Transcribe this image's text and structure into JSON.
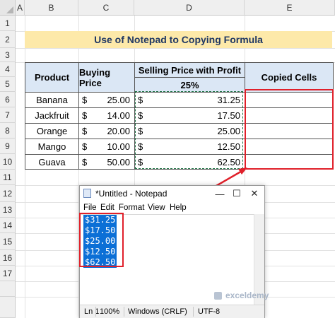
{
  "spreadsheet": {
    "columns": [
      "A",
      "B",
      "C",
      "D",
      "E"
    ],
    "rows": [
      "1",
      "2",
      "3",
      "4",
      "5",
      "6",
      "7",
      "8",
      "9",
      "10",
      "11",
      "12",
      "13",
      "14",
      "15",
      "16",
      "17"
    ],
    "title": "Use of Notepad to Copying Formula",
    "headers": {
      "product": "Product",
      "buying_price": "Buying Price",
      "selling_price": "Selling Price with Profit",
      "profit_rate": "25%",
      "copied": "Copied Cells"
    },
    "currency": "$",
    "data_rows": [
      {
        "product": "Banana",
        "buying": "25.00",
        "selling": "31.25"
      },
      {
        "product": "Jackfruit",
        "buying": "14.00",
        "selling": "17.50"
      },
      {
        "product": "Orange",
        "buying": "20.00",
        "selling": "25.00"
      },
      {
        "product": "Mango",
        "buying": "10.00",
        "selling": "12.50"
      },
      {
        "product": "Guava",
        "buying": "50.00",
        "selling": "62.50"
      }
    ]
  },
  "notepad": {
    "title": "*Untitled - Notepad",
    "controls": {
      "minimize": "—",
      "maximize": "☐",
      "close": "✕"
    },
    "menu": [
      "File",
      "Edit",
      "Format",
      "View",
      "Help"
    ],
    "content_lines": [
      "$31.25",
      "$17.50",
      "$25.00",
      "$12.50",
      "$62.50"
    ],
    "status": {
      "position": "Ln 1",
      "zoom": "100%",
      "line_ending": "Windows (CRLF)",
      "encoding": "UTF-8"
    },
    "watermark": "exceldemy"
  },
  "colors": {
    "title_fill": "#fde9a9",
    "header_fill": "#dbe7f5",
    "highlight_border": "#e0202a",
    "selection": "#0b6fd6",
    "marquee": "#217346"
  }
}
